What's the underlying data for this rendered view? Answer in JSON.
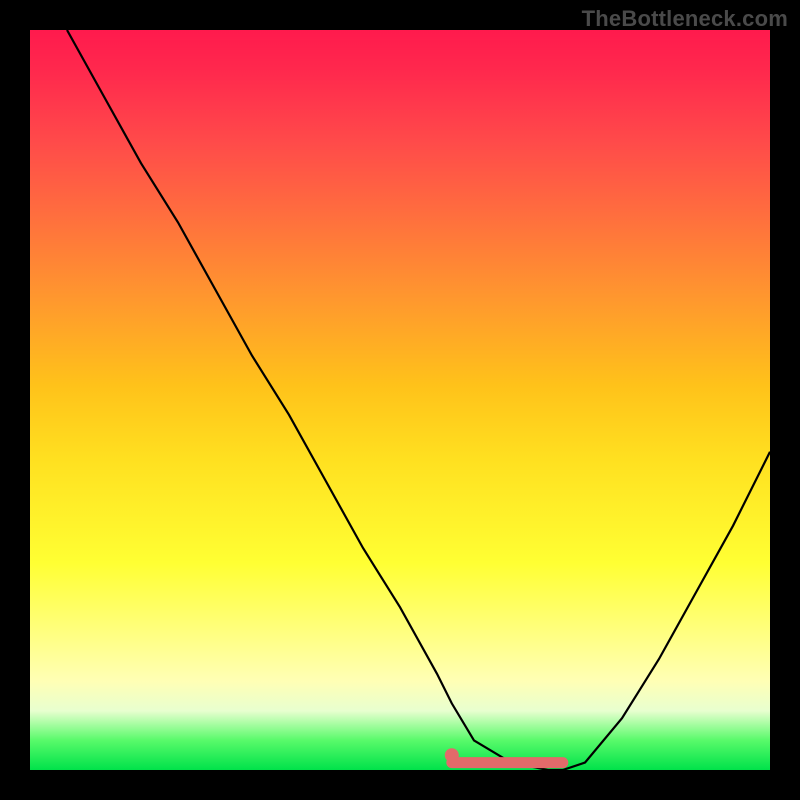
{
  "attribution": "TheBottleneck.com",
  "colors": {
    "curve_stroke": "#000000",
    "flat_stroke": "#e26a6a",
    "dot_fill": "#e26a6a",
    "gradient_top": "#ff1a4d",
    "gradient_mid1": "#ff6e3e",
    "gradient_mid2": "#ffe020",
    "gradient_mid3": "#ffffb5",
    "gradient_bottom": "#00e24a"
  },
  "chart_data": {
    "type": "line",
    "title": "",
    "xlabel": "",
    "ylabel": "",
    "xlim": [
      0,
      100
    ],
    "ylim": [
      0,
      100
    ],
    "grid": false,
    "legend": false,
    "series": [
      {
        "name": "bottleneck-curve",
        "x": [
          5,
          10,
          15,
          20,
          25,
          30,
          35,
          40,
          45,
          50,
          55,
          57,
          60,
          65,
          70,
          72,
          75,
          80,
          85,
          90,
          95,
          100
        ],
        "values": [
          100,
          91,
          82,
          74,
          65,
          56,
          48,
          39,
          30,
          22,
          13,
          9,
          4,
          1,
          0,
          0,
          1,
          7,
          15,
          24,
          33,
          43
        ]
      }
    ],
    "annotations": [
      {
        "name": "flat-bottom-segment",
        "x_start": 57,
        "x_end": 72,
        "y": 1
      },
      {
        "name": "marker-dot",
        "x": 57,
        "y": 2
      }
    ]
  }
}
